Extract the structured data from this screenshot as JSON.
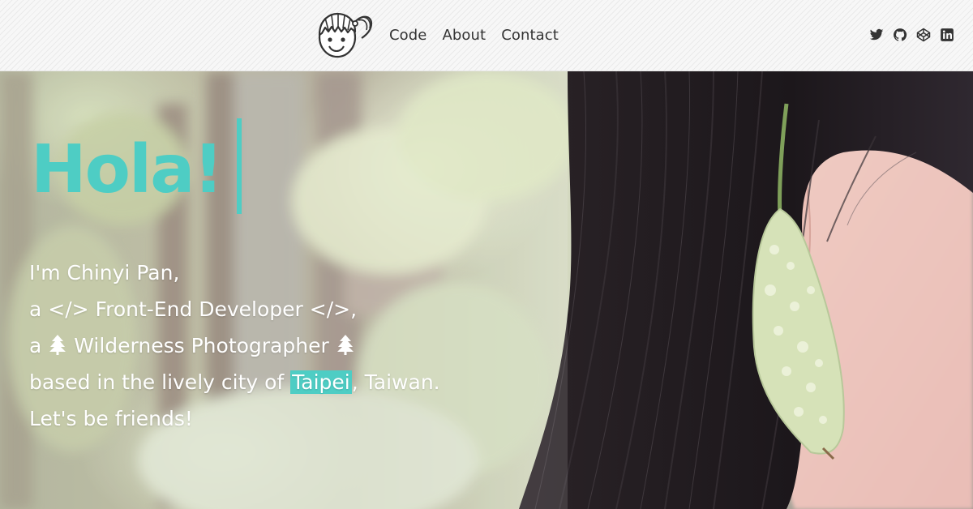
{
  "nav": {
    "logo_alt": "Chinyi Pan avatar",
    "links": [
      "Code",
      "About",
      "Contact"
    ]
  },
  "social": {
    "icons": [
      "twitter-icon",
      "github-icon",
      "codepen-icon",
      "linkedin-icon"
    ]
  },
  "hero": {
    "greeting": "Hola!",
    "line1": "I'm Chinyi Pan,",
    "line2_prefix": "a </> Front-End Developer </>,",
    "line3_prefix": "a",
    "line3_text": " Wilderness Photographer ",
    "line4_prefix": "based in the lively city of ",
    "line4_highlight": "Taipei",
    "line4_suffix": ", Taiwan.",
    "line5": "Let's be friends!"
  },
  "colors": {
    "accent": "#4ecdc4",
    "nav_text": "#333333",
    "intro_text": "#ffffff"
  }
}
